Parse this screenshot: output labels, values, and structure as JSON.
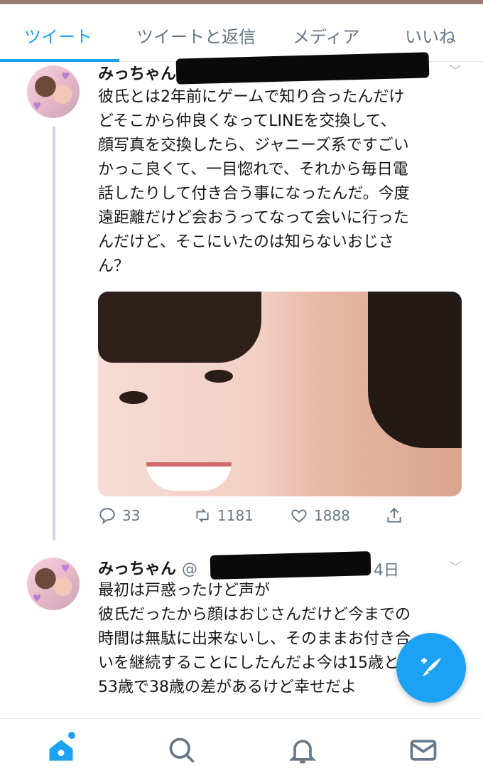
{
  "tabs": [
    {
      "label": "ツイート",
      "active": true
    },
    {
      "label": "ツイートと返信",
      "active": false
    },
    {
      "label": "メディア",
      "active": false
    },
    {
      "label": "いいね",
      "active": false
    }
  ],
  "tweets": [
    {
      "name": "みっちゃん",
      "time": "",
      "lines": [
        "彼氏とは2年前にゲームで知り合ったんだけ",
        "どそこから仲良くなってLINEを交換して、",
        "顔写真を交換したら、ジャニーズ系ですごい",
        "かっこ良くて、一目惚れで、それから毎日電",
        "話したりして付き合う事になったんだ。今度",
        "遠距離だけど会おうってなって会いに行った",
        "んだけど、そこにいたのは知らないおじさ",
        "ん？"
      ],
      "reply_count": "33",
      "retweet_count": "1181",
      "like_count": "1888"
    },
    {
      "name": "みっちゃん",
      "handle_prefix": "@",
      "time": "4日",
      "lines": [
        "最初は戸惑ったけど声が",
        "彼氏だったから顔はおじさんだけど今までの",
        "時間は無駄に出来ないし、そのままお付き合",
        "いを継続することにしたんだよ今は15歳と",
        "53歳で38歳の差があるけど幸せだよ"
      ]
    }
  ],
  "icons": {
    "reply": "reply-icon",
    "retweet": "retweet-icon",
    "like": "like-icon",
    "share": "share-icon",
    "compose": "compose-icon",
    "home": "home-icon",
    "search": "search-icon",
    "notifications": "bell-icon",
    "messages": "mail-icon"
  },
  "colors": {
    "accent": "#1da1f2",
    "secondary_text": "#657786"
  }
}
